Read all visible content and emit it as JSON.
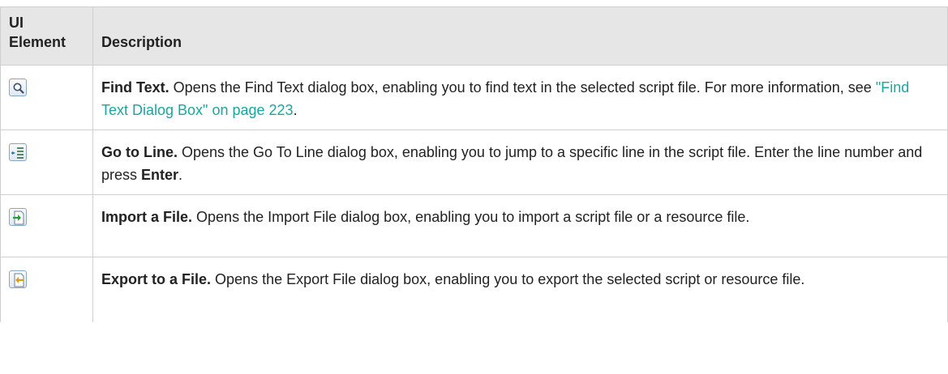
{
  "header": {
    "col_ui": "UI Element",
    "col_ui_line1": "UI",
    "col_ui_line2": "Element",
    "col_desc": "Description"
  },
  "rows": [
    {
      "icon": "find-text-icon",
      "title": "Find Text.",
      "text": " Opens the Find Text dialog box, enabling you to find text in the selected script file. For more information, see ",
      "link": "\"Find Text Dialog Box\" on page 223",
      "after": "."
    },
    {
      "icon": "go-to-line-icon",
      "title": "Go to Line.",
      "text": " Opens the Go To Line dialog box, enabling you to jump to a specific line in the script file. Enter the line number and press ",
      "bold_end": "Enter",
      "after": "."
    },
    {
      "icon": "import-file-icon",
      "title": "Import a File.",
      "text": " Opens the Import File dialog box, enabling you to import a script file or a resource file."
    },
    {
      "icon": "export-file-icon",
      "title": "Export to a File.",
      "text": " Opens the Export File dialog box, enabling you to export the selected script or resource file."
    }
  ],
  "colors": {
    "header_bg": "#e6e6e6",
    "border": "#cfcfcf",
    "link": "#1aa5a0"
  }
}
